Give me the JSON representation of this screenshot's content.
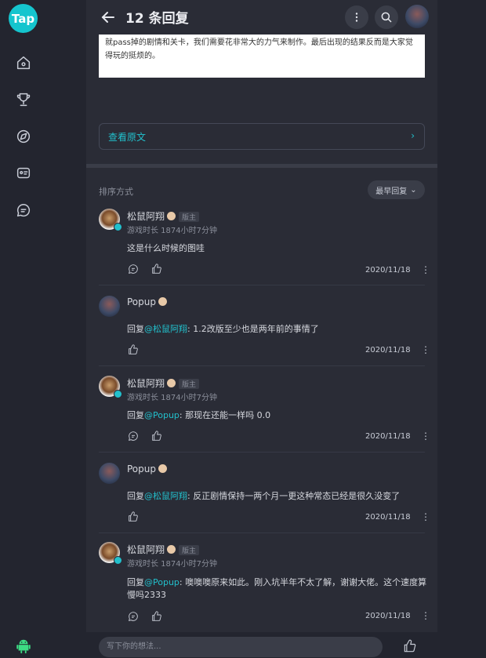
{
  "app": {
    "logo_text": "Tap"
  },
  "header": {
    "title": "12 条回复"
  },
  "quoted_image_text": "就pass掉的剧情和关卡，我们需要花非常大的力气来制作。最后出现的结果反而是大家觉得玩的挺烦的。",
  "view_original": "查看原文",
  "sort": {
    "label": "排序方式",
    "value": "最早回复"
  },
  "input_placeholder": "写下你的想法...",
  "replies": [
    {
      "name": "松鼠阿翔",
      "tag": "版主",
      "playtime": "游戏时长 1874小时7分钟",
      "reply_prefix": "",
      "mention": "",
      "text": "这是什么时候的图哇",
      "date": "2020/11/18"
    },
    {
      "name": "Popup",
      "tag": "",
      "playtime": "",
      "reply_prefix": "回复",
      "mention": "@松鼠阿翔",
      "text": ": 1.2改版至少也是两年前的事情了",
      "date": "2020/11/18"
    },
    {
      "name": "松鼠阿翔",
      "tag": "版主",
      "playtime": "游戏时长 1874小时7分钟",
      "reply_prefix": "回复",
      "mention": "@Popup",
      "text": ": 那现在还能一样吗 0.0",
      "date": "2020/11/18"
    },
    {
      "name": "Popup",
      "tag": "",
      "playtime": "",
      "reply_prefix": "回复",
      "mention": "@松鼠阿翔",
      "text": ": 反正剧情保持一两个月一更这种常态已经是很久没变了",
      "date": "2020/11/18"
    },
    {
      "name": "松鼠阿翔",
      "tag": "版主",
      "playtime": "游戏时长 1874小时7分钟",
      "reply_prefix": "回复",
      "mention": "@Popup",
      "text": ": 噢噢噢原来如此。刚入坑半年不太了解，谢谢大佬。这个速度算慢吗2333",
      "date": "2020/11/18"
    }
  ],
  "colors": {
    "accent": "#22c0cc",
    "logo": "#15c5ce",
    "panel": "#2a2c36",
    "background": "#23252f"
  }
}
